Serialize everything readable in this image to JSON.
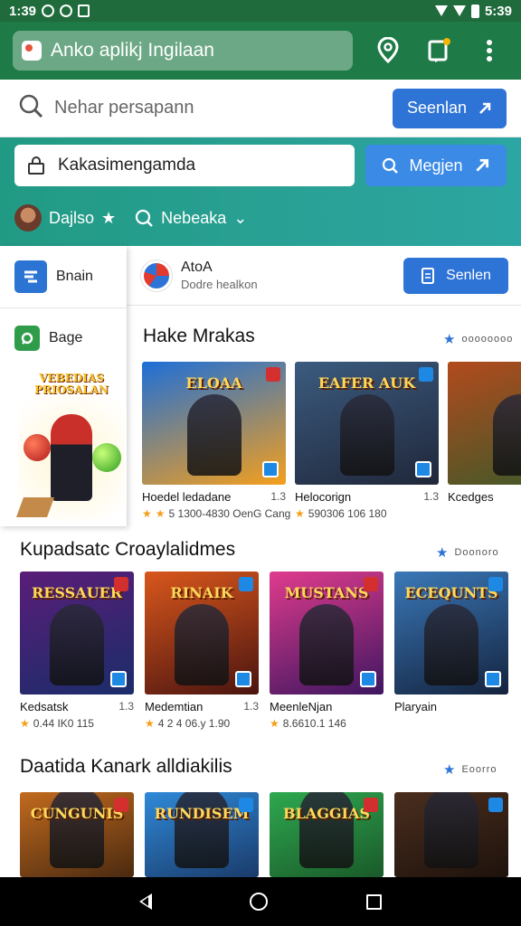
{
  "status_bar": {
    "time": "1:39",
    "time_right": "5:39"
  },
  "app_bar": {
    "title": "Anko aplikj Ingilaan"
  },
  "search": {
    "placeholder": "Nehar persapann",
    "button_label": "Seenlan"
  },
  "banner": {
    "input_value": "Kakasimengamda",
    "button_label": "Megjen",
    "chips": [
      {
        "label": "Dajlso",
        "icon": "star-icon"
      },
      {
        "label": "Nebeaka",
        "icon": "search-icon"
      }
    ]
  },
  "left_panel": {
    "items": [
      {
        "label": "Bnain",
        "icon": "app-icon"
      },
      {
        "label": "Bage",
        "icon": "bag-icon"
      }
    ],
    "promo_title": "VEBEDIAS PRIOSALAN"
  },
  "header_row": {
    "title": "AtoA",
    "subtitle": "Dodre healkon",
    "button_label": "Senlen"
  },
  "sections": [
    {
      "title": "Hake Mrakas",
      "see_all": "oooooooo",
      "cards": [
        {
          "name": "Hoedel ledadane",
          "size": "1.3",
          "meta": "5 1300-4830 OenG Cang",
          "stars": 2,
          "tile_text": "ELOAA",
          "bg": [
            "#1d6fd8",
            "#f59f1c"
          ]
        },
        {
          "name": "Helocorign",
          "size": "1.3",
          "meta": "590306 106 180",
          "stars": 0,
          "tile_text": "EAFER AUK",
          "bg": [
            "#3b5b7f",
            "#20273a"
          ]
        },
        {
          "name": "Kcedges",
          "size": "",
          "meta": "",
          "stars": 0,
          "tile_text": "",
          "bg": [
            "#b24a1d",
            "#385a2a"
          ]
        }
      ]
    },
    {
      "title": "Kupadsatc Croaylalidmes",
      "see_all": "Doonoro",
      "cards": [
        {
          "name": "Kedsatsk",
          "size": "1.3",
          "meta": "0.44 IK0 115",
          "tile_text": "RESSAUER",
          "bg": [
            "#5a1d78",
            "#1a2d6a"
          ]
        },
        {
          "name": "Medemtian",
          "size": "1.3",
          "meta": "4 2 4 06.y 1.90",
          "tile_text": "RINAIK",
          "bg": [
            "#d9571c",
            "#4a1410"
          ]
        },
        {
          "name": "MeenleNjan",
          "size": "",
          "meta": "8.6610.1 146",
          "tile_text": "MUSTANS",
          "bg": [
            "#e03b8d",
            "#3e1660"
          ]
        },
        {
          "name": "Plaryain",
          "size": "",
          "meta": "",
          "tile_text": "ECEQUNTS",
          "bg": [
            "#3a78b8",
            "#14233e"
          ]
        }
      ]
    },
    {
      "title": "Daatida Kanark alldiakilis",
      "see_all": "Eoorro",
      "cards": [
        {
          "tile_text": "CUNGUNIS",
          "bg": [
            "#c26a1e",
            "#4a2a10"
          ]
        },
        {
          "tile_text": "RUNDISEM",
          "bg": [
            "#2f89d8",
            "#1a3b6a"
          ]
        },
        {
          "tile_text": "BLAGGIAS",
          "bg": [
            "#2ea84f",
            "#1a5a2a"
          ]
        },
        {
          "tile_text": "",
          "bg": [
            "#4a2e1e",
            "#1e120c"
          ]
        }
      ]
    }
  ]
}
